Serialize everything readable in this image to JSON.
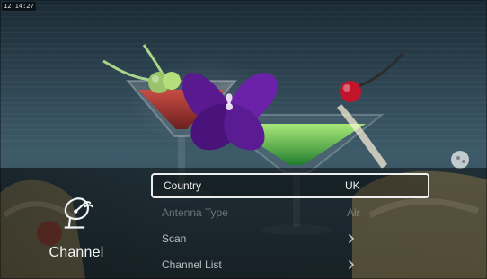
{
  "status": {
    "time": "12:14:27"
  },
  "category": {
    "icon": "satellite-dish-icon",
    "label": "Channel"
  },
  "menu": {
    "items": [
      {
        "label": "Country",
        "value": "UK",
        "state": "selected"
      },
      {
        "label": "Antenna Type",
        "value": "Air",
        "state": "disabled"
      },
      {
        "label": "Scan",
        "value": "",
        "state": "normal",
        "chevron": true
      },
      {
        "label": "Channel List",
        "value": "",
        "state": "normal",
        "chevron": true
      }
    ]
  },
  "colors": {
    "overlay": "#000000",
    "text": "#F2F5F7",
    "highlight_border": "#FFFFFF"
  }
}
